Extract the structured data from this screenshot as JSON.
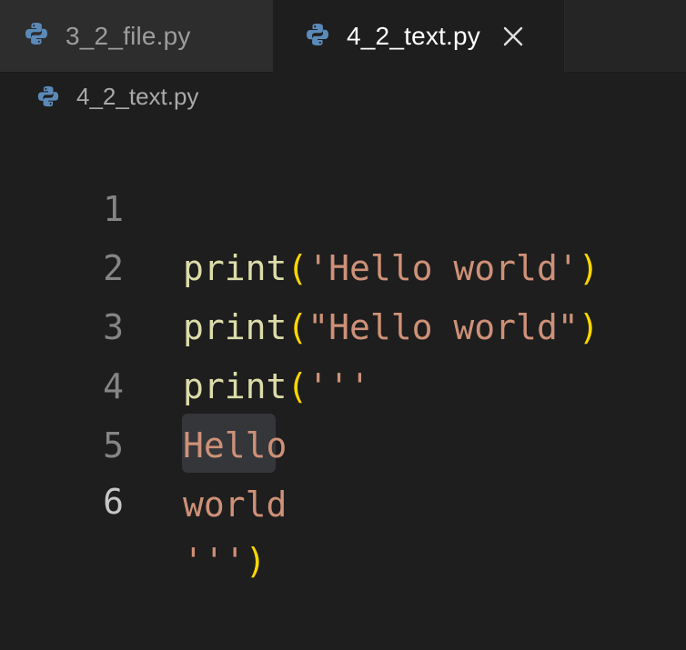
{
  "tabs": [
    {
      "label": "3_2_file.py",
      "active": false,
      "icon": "python-icon"
    },
    {
      "label": "4_2_text.py",
      "active": true,
      "icon": "python-icon",
      "close_icon": "close-icon"
    }
  ],
  "breadcrumb": {
    "label": "4_2_text.py",
    "icon": "python-icon"
  },
  "editor": {
    "current_line": 6,
    "lines": [
      {
        "number": "1",
        "fn": "print",
        "open": "(",
        "str": "'Hello world'",
        "close": ")"
      },
      {
        "number": "2",
        "fn": "print",
        "open": "(",
        "str": "\"Hello world\"",
        "close": ")"
      },
      {
        "number": "3",
        "fn": "print",
        "open": "(",
        "str": "'''",
        "close": ""
      },
      {
        "number": "4",
        "fn": "",
        "open": "",
        "str": "Hello",
        "close": ""
      },
      {
        "number": "5",
        "fn": "",
        "open": "",
        "str": "world",
        "close": ""
      },
      {
        "number": "6",
        "fn": "",
        "open": "",
        "str": "'''",
        "close": ")"
      }
    ]
  },
  "colors": {
    "background": "#1e1e1e",
    "function": "#dcdcaa",
    "string": "#ce9178",
    "bracket": "#ffd700",
    "line_number": "#858585",
    "active_line_number": "#c6c6c6"
  }
}
